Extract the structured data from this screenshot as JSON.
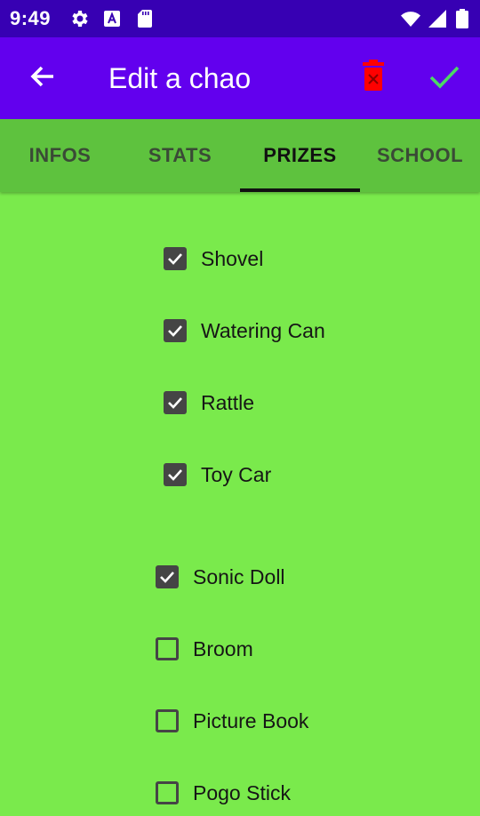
{
  "status_bar": {
    "time": "9:49",
    "icons": [
      "settings-icon",
      "notification-a-icon",
      "sd-card-icon",
      "wifi-icon",
      "signal-icon",
      "battery-icon"
    ]
  },
  "app_bar": {
    "title": "Edit a chao",
    "back_icon": "arrow-back-icon",
    "delete_icon": "trash-icon",
    "save_icon": "checkmark-icon",
    "colors": {
      "bar": "#6200ee",
      "status": "#3700b3",
      "delete": "#ff0000",
      "save": "#4cd964"
    }
  },
  "tabs": [
    {
      "label": "INFOS",
      "active": false
    },
    {
      "label": "STATS",
      "active": false
    },
    {
      "label": "PRIZES",
      "active": true
    },
    {
      "label": "SCHOOL",
      "active": false
    }
  ],
  "prizes": [
    {
      "label": "Shovel",
      "checked": true
    },
    {
      "label": "Watering Can",
      "checked": true
    },
    {
      "label": "Rattle",
      "checked": true
    },
    {
      "label": "Toy Car",
      "checked": true
    },
    {
      "label": "Sonic Doll",
      "checked": true
    },
    {
      "label": "Broom",
      "checked": false
    },
    {
      "label": "Picture Book",
      "checked": false
    },
    {
      "label": "Pogo Stick",
      "checked": false
    }
  ],
  "colors": {
    "background": "#7aea4c",
    "tabs_background": "#5ec23e"
  }
}
